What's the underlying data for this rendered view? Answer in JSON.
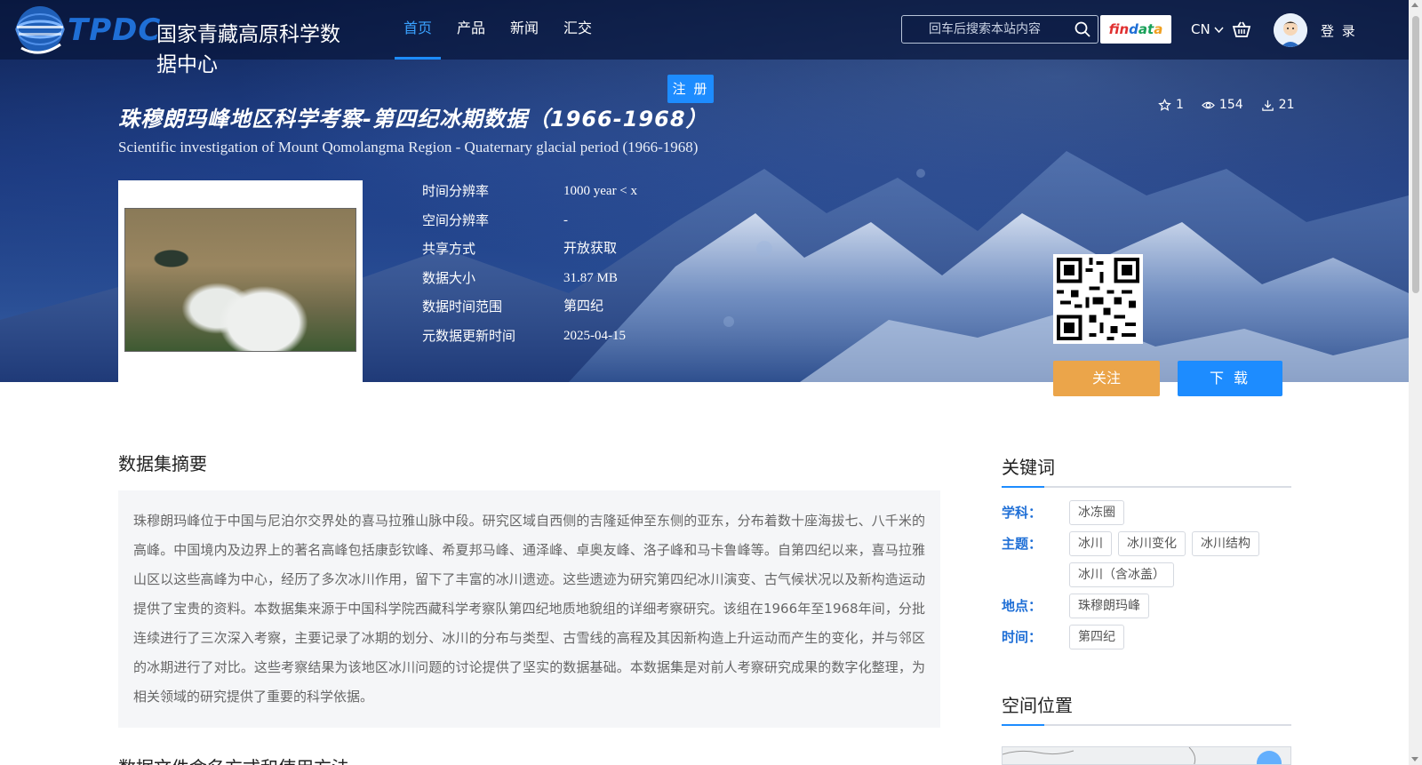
{
  "header": {
    "logo_abbr": "TPDC",
    "logo_name": "国家青藏高原科学数据中心",
    "nav": [
      "首页",
      "产品",
      "新闻",
      "汇交"
    ],
    "active_nav": "首页",
    "search_placeholder": "回车后搜索本站内容",
    "findata": {
      "p1": "fin",
      "p2": "d",
      "p3": "at",
      "p4": "a"
    },
    "lang": "CN",
    "login": "登 录"
  },
  "register_label": "注 册",
  "dataset": {
    "title_cn": "珠穆朗玛峰地区科学考察-第四纪冰期数据（1966-1968）",
    "title_en": "Scientific investigation of Mount Qomolangma Region - Quaternary glacial period (1966-1968)",
    "stats": {
      "favorites": "1",
      "views": "154",
      "downloads": "21"
    },
    "meta": [
      {
        "label": "时间分辨率",
        "value": "1000 year < x"
      },
      {
        "label": "空间分辨率",
        "value": "-"
      },
      {
        "label": "共享方式",
        "value": "开放获取"
      },
      {
        "label": "数据大小",
        "value": "31.87 MB"
      },
      {
        "label": "数据时间范围",
        "value": "第四纪"
      },
      {
        "label": "元数据更新时间",
        "value": "2025-04-15"
      }
    ],
    "follow_label": "关注",
    "download_label": "下 载"
  },
  "abstract": {
    "title": "数据集摘要",
    "text": "珠穆朗玛峰位于中国与尼泊尔交界处的喜马拉雅山脉中段。研究区域自西侧的吉隆延伸至东侧的亚东，分布着数十座海拔七、八千米的高峰。中国境内及边界上的著名高峰包括康彭钦峰、希夏邦马峰、通泽峰、卓奥友峰、洛子峰和马卡鲁峰等。自第四纪以来，喜马拉雅山区以这些高峰为中心，经历了多次冰川作用，留下了丰富的冰川遗迹。这些遗迹为研究第四纪冰川演变、古气候状况以及新构造运动提供了宝贵的资料。本数据集来源于中国科学院西藏科学考察队第四纪地质地貌组的详细考察研究。该组在1966年至1968年间，分批连续进行了三次深入考察，主要记录了冰期的划分、冰川的分布与类型、古雪线的高程及其因新构造上升运动而产生的变化，并与邻区的冰期进行了对比。这些考察结果为该地区冰川问题的讨论提供了坚实的数据基础。本数据集是对前人考察研究成果的数字化整理，为相关领域的研究提供了重要的科学依据。"
  },
  "next_section_title": "数据文件命名方式和使用方法",
  "keywords": {
    "title": "关键词",
    "groups": [
      {
        "label": "学科：",
        "tags": [
          "冰冻圈"
        ]
      },
      {
        "label": "主题：",
        "tags": [
          "冰川",
          "冰川变化",
          "冰川结构",
          "冰川（含冰盖）"
        ]
      },
      {
        "label": "地点：",
        "tags": [
          "珠穆朗玛峰"
        ]
      },
      {
        "label": "时间：",
        "tags": [
          "第四纪"
        ]
      }
    ]
  },
  "spatial": {
    "title": "空间位置"
  },
  "colors": {
    "accent": "#1d8cff",
    "follow": "#eba54a",
    "keyword_label": "#1f6fd6"
  }
}
